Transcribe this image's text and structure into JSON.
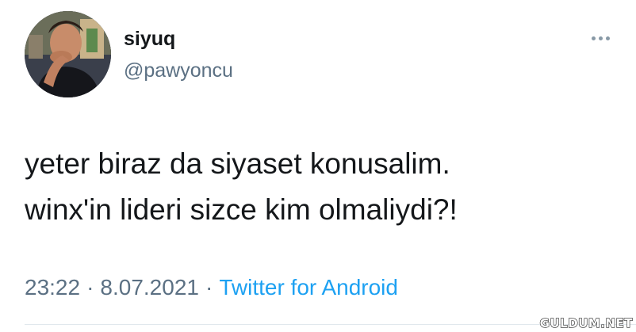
{
  "tweet": {
    "author": {
      "display_name": "siyuq",
      "handle": "@pawyoncu"
    },
    "text_lines": [
      "yeter biraz da siyaset konusalim.",
      "winx'in lideri sizce kim olmaliydi?!"
    ],
    "time": "23:22",
    "date": "8.07.2021",
    "separator": "·",
    "source": "Twitter for Android"
  },
  "icons": {
    "more": "more-horizontal-icon"
  },
  "colors": {
    "text": "#14171a",
    "secondary": "#5b7083",
    "link": "#1da1f2",
    "divider": "#e1e8ed"
  },
  "watermark": "GULDUM.NET"
}
